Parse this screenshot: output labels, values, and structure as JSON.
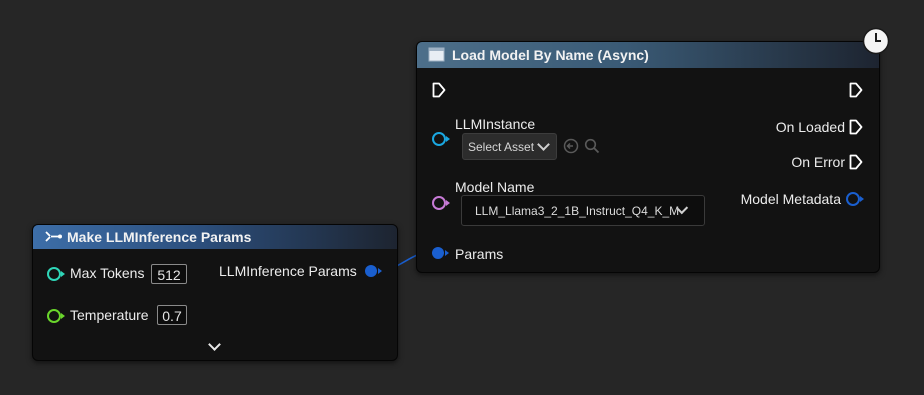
{
  "make_node": {
    "title": "Make LLMInference Params",
    "max_tokens_label": "Max Tokens",
    "max_tokens_value": "512",
    "temperature_label": "Temperature",
    "temperature_value": "0.7",
    "output_label": "LLMInference Params"
  },
  "load_node": {
    "title": "Load Model By Name (Async)",
    "llm_instance_label": "LLMInstance",
    "select_asset_placeholder": "Select Asset",
    "on_loaded_label": "On Loaded",
    "on_error_label": "On Error",
    "model_name_label": "Model Name",
    "model_name_value": "LLM_Llama3_2_1B_Instruct_Q4_K_M",
    "model_metadata_label": "Model Metadata",
    "params_label": "Params"
  },
  "colors": {
    "object_pin": "#1aa7e0",
    "string_pin": "#c77ad6",
    "struct_pin": "#1a5fcf",
    "int_pin": "#2fd6b8",
    "float_pin": "#6ad62c",
    "wire": "#1a5fcf"
  }
}
